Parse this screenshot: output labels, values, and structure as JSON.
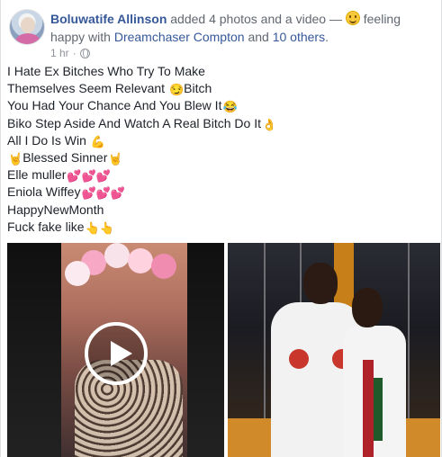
{
  "post": {
    "author": "Boluwatife Allinson",
    "action_text": "added 4 photos and a video —",
    "feeling_text": "feeling happy with",
    "tagged_person": "Dreamchaser Compton",
    "and_text": "and",
    "others_link": "10 others",
    "period": ".",
    "timestamp": "1 hr",
    "separator": "·",
    "privacy_icon": "globe-icon",
    "lines": [
      {
        "text": "I Hate Ex Bitches Who Try To Make",
        "emoji": ""
      },
      {
        "text": "Themselves Seem Relevant ",
        "emoji": "😏",
        "after": "Bitch"
      },
      {
        "text": "You Had Your Chance And You Blew It",
        "emoji": "😂"
      },
      {
        "text": "Biko Step Aside And Watch A Real Bitch Do It",
        "emoji": "👌"
      },
      {
        "text": "All I Do Is Win ",
        "emoji": "💪"
      },
      {
        "pre_emoji": "🤘",
        "text": "Blessed Sinner",
        "emoji": "🤘"
      },
      {
        "text": "Elle muller",
        "emoji": "💕💕💕"
      },
      {
        "text": "Eniola Wiffey",
        "emoji": "💕💕💕"
      },
      {
        "text": "HappyNewMonth",
        "emoji": ""
      },
      {
        "text": "Fuck fake like",
        "emoji": "👆👆"
      }
    ]
  },
  "media": {
    "video_icon": "play-icon",
    "colors": {
      "link": "#365899",
      "muted": "#616770",
      "meta": "#90949c",
      "text": "#1d2129"
    }
  }
}
